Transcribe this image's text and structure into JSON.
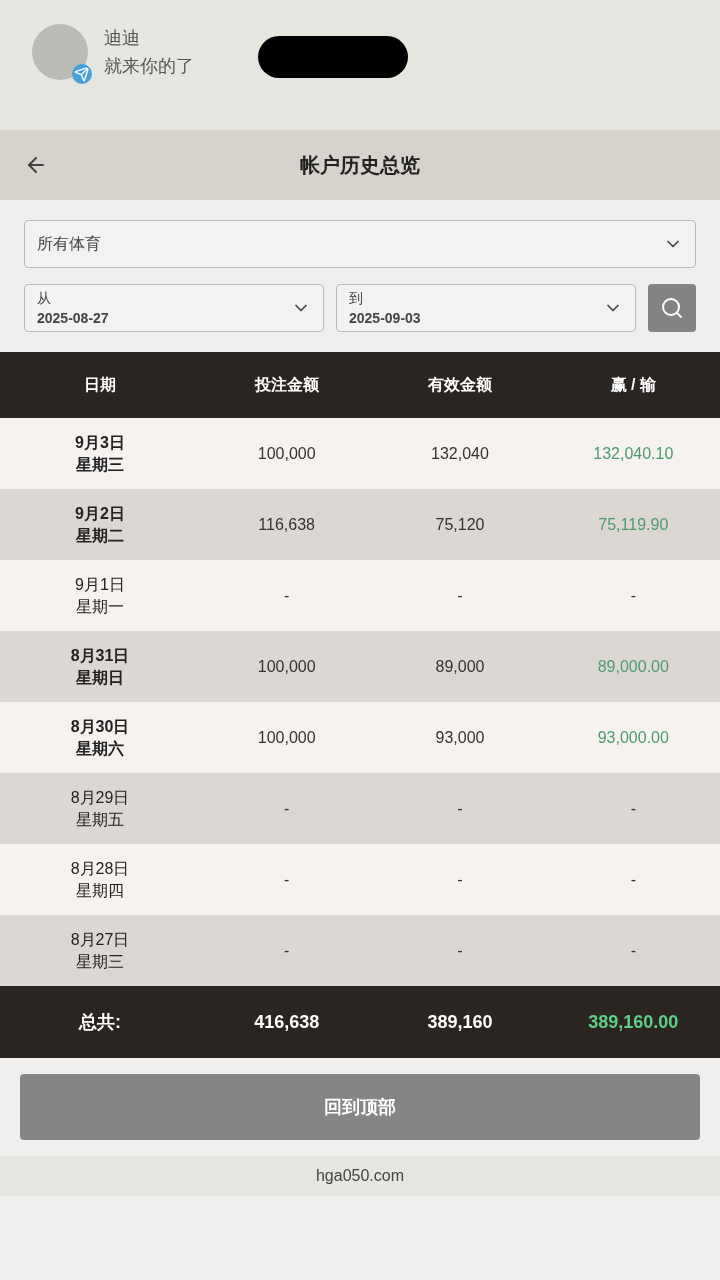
{
  "notification": {
    "sender": "迪迪",
    "message": "就来你的了"
  },
  "header": {
    "title": "帐户历史总览"
  },
  "filters": {
    "sport": "所有体育",
    "from": {
      "label": "从",
      "value": "2025-08-27"
    },
    "to": {
      "label": "到",
      "value": "2025-09-03"
    }
  },
  "table": {
    "columns": [
      "日期",
      "投注金额",
      "有效金额",
      "赢 / 输"
    ],
    "rows": [
      {
        "date": "9月3日",
        "weekday": "星期三",
        "stake": "100,000",
        "valid": "132,040",
        "result": "132,040.10",
        "highlighted": true
      },
      {
        "date": "9月2日",
        "weekday": "星期二",
        "stake": "116,638",
        "valid": "75,120",
        "result": "75,119.90",
        "highlighted": true
      },
      {
        "date": "9月1日",
        "weekday": "星期一",
        "stake": "-",
        "valid": "-",
        "result": "-",
        "highlighted": false
      },
      {
        "date": "8月31日",
        "weekday": "星期日",
        "stake": "100,000",
        "valid": "89,000",
        "result": "89,000.00",
        "highlighted": true
      },
      {
        "date": "8月30日",
        "weekday": "星期六",
        "stake": "100,000",
        "valid": "93,000",
        "result": "93,000.00",
        "highlighted": true
      },
      {
        "date": "8月29日",
        "weekday": "星期五",
        "stake": "-",
        "valid": "-",
        "result": "-",
        "highlighted": false
      },
      {
        "date": "8月28日",
        "weekday": "星期四",
        "stake": "-",
        "valid": "-",
        "result": "-",
        "highlighted": false
      },
      {
        "date": "8月27日",
        "weekday": "星期三",
        "stake": "-",
        "valid": "-",
        "result": "-",
        "highlighted": false
      }
    ],
    "total": {
      "label": "总共:",
      "stake": "416,638",
      "valid": "389,160",
      "result": "389,160.00"
    }
  },
  "back_to_top": "回到顶部",
  "url": "hga050.com"
}
